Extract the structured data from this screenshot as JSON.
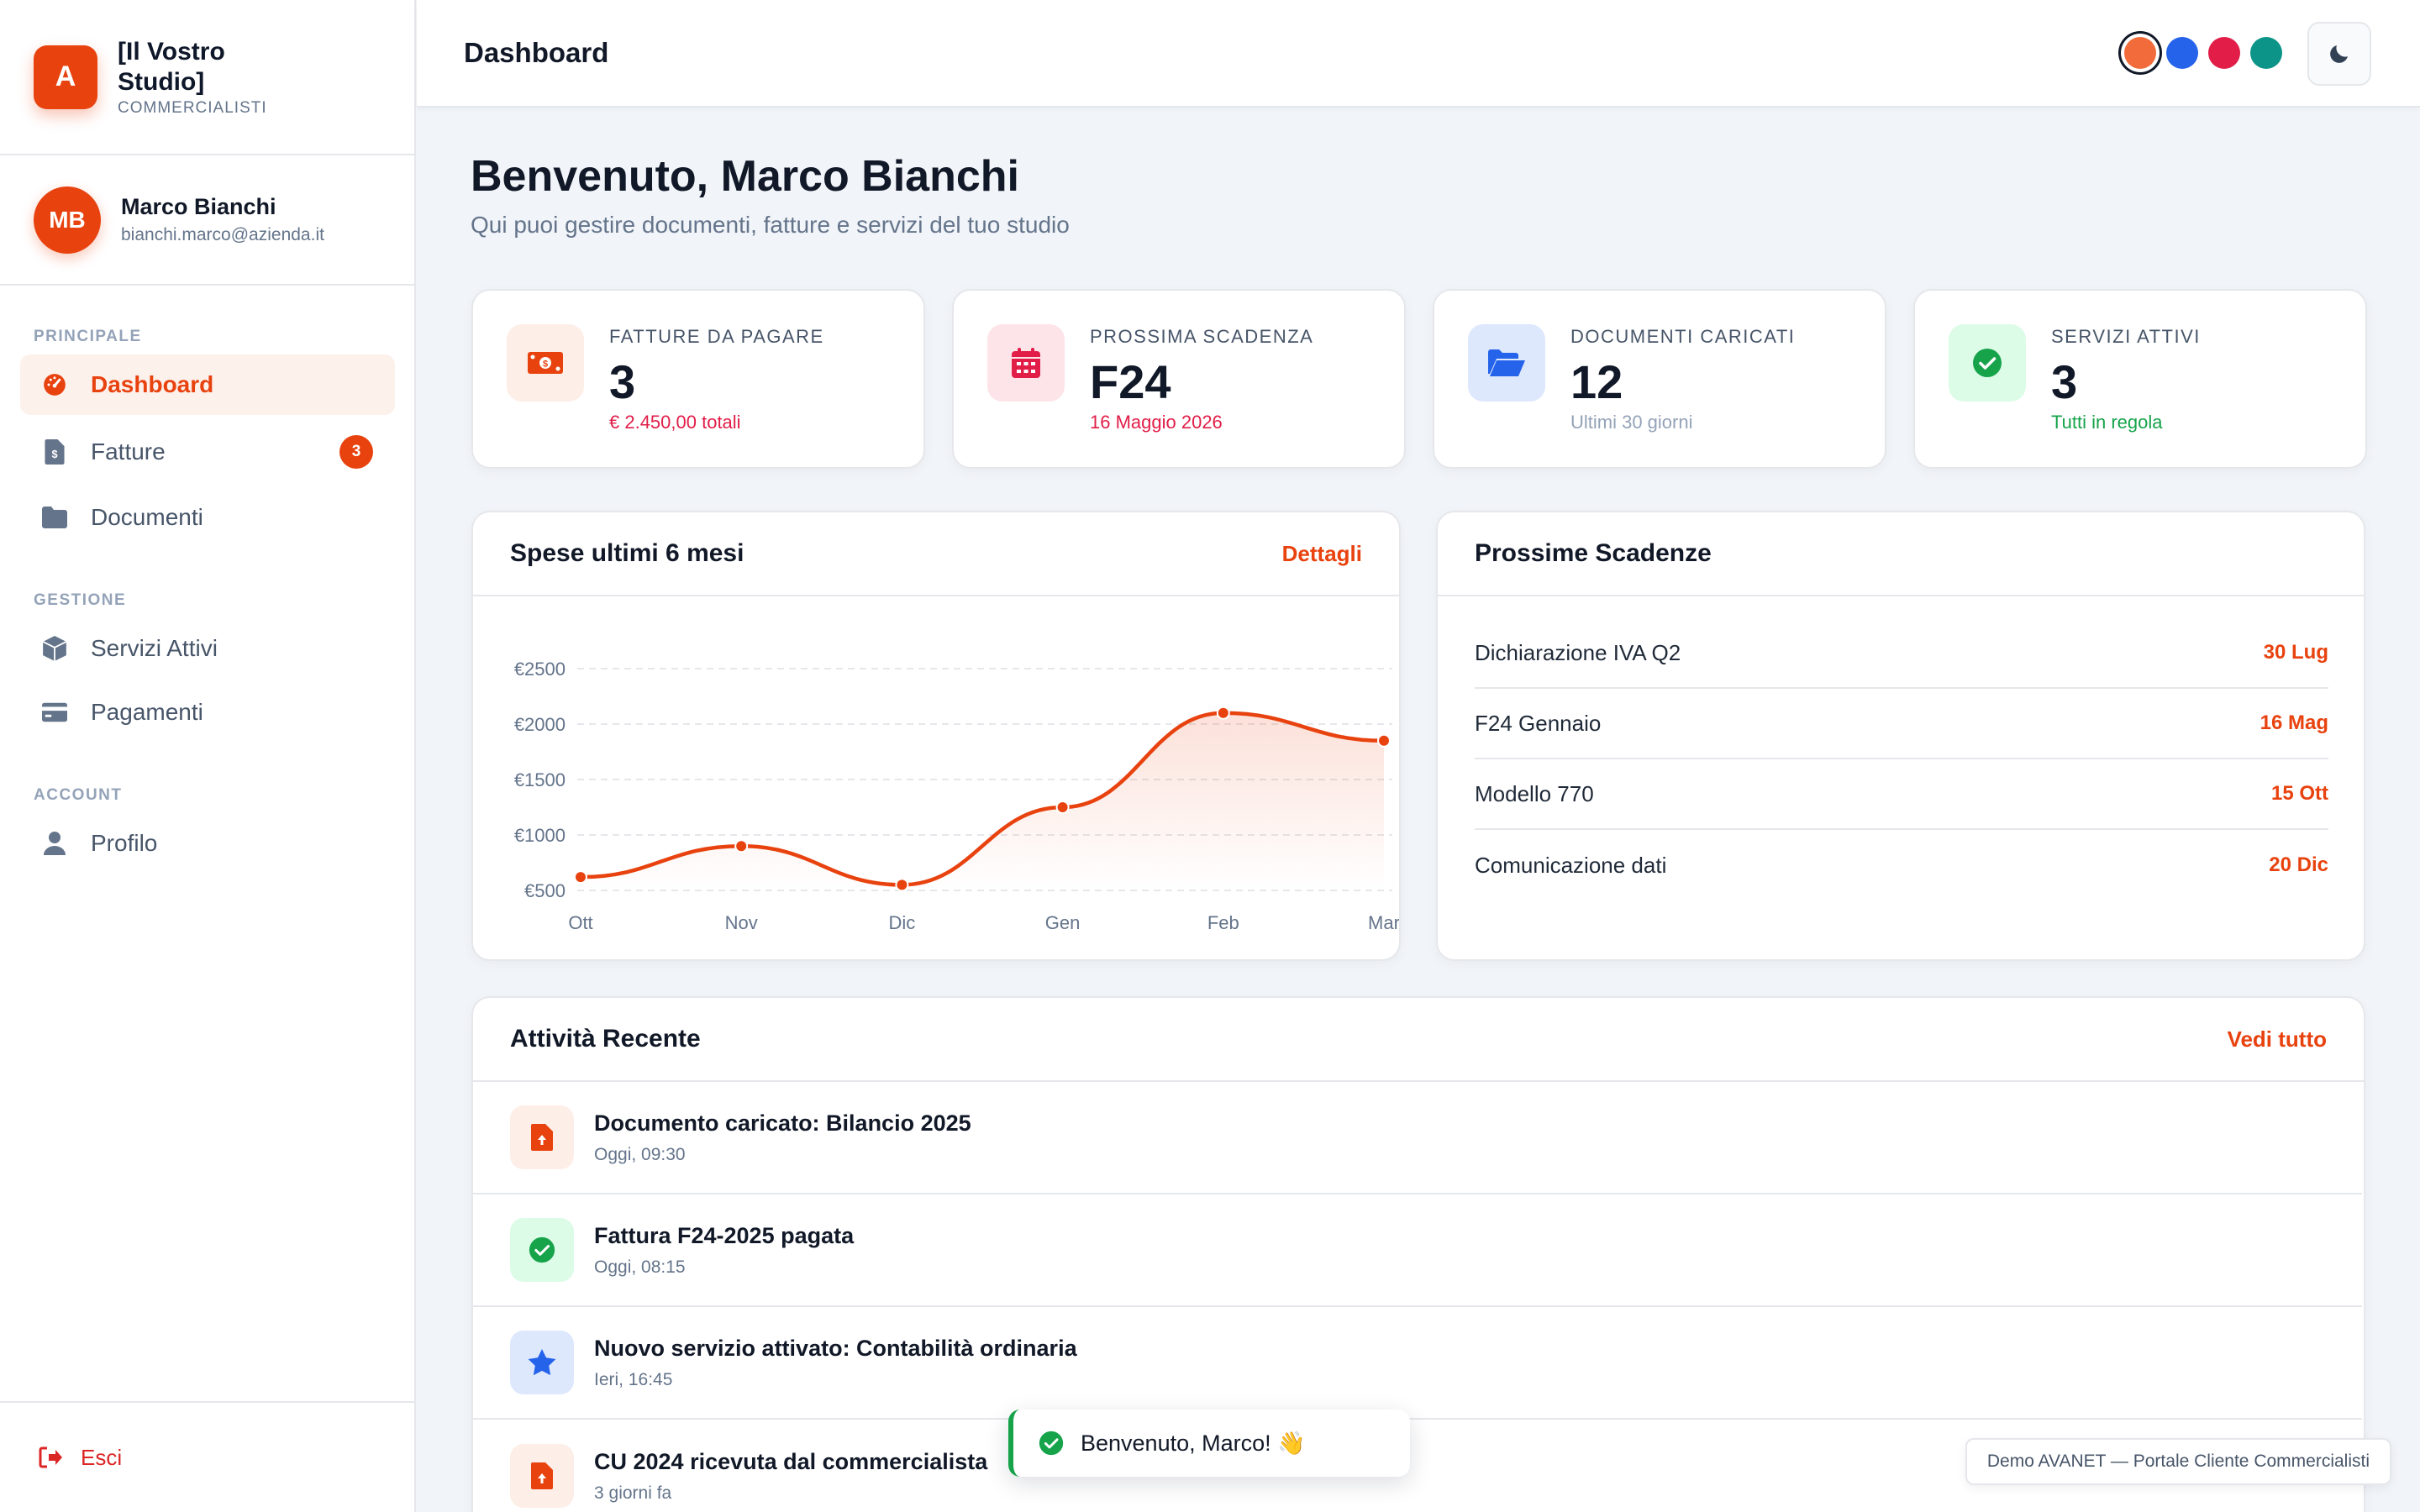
{
  "brand": {
    "logo_letter": "A",
    "name": "[Il Vostro Studio]",
    "subtitle": "COMMERCIALISTI"
  },
  "user": {
    "initials": "MB",
    "name": "Marco Bianchi",
    "email": "bianchi.marco@azienda.it"
  },
  "nav": {
    "sections": [
      "PRINCIPALE",
      "GESTIONE",
      "ACCOUNT"
    ],
    "items": [
      {
        "label": "Dashboard",
        "icon": "gauge-icon",
        "active": true
      },
      {
        "label": "Fatture",
        "icon": "invoice-icon",
        "badge": "3"
      },
      {
        "label": "Documenti",
        "icon": "folder-icon"
      },
      {
        "label": "Servizi Attivi",
        "icon": "box-icon"
      },
      {
        "label": "Pagamenti",
        "icon": "credit-card-icon"
      },
      {
        "label": "Profilo",
        "icon": "user-icon"
      }
    ],
    "logout": "Esci"
  },
  "header": {
    "title": "Dashboard",
    "theme_colors": [
      "#f26b3a",
      "#2563eb",
      "#e11d48",
      "#0d9488"
    ],
    "theme_toggle_icon": "moon-icon"
  },
  "welcome": {
    "title": "Benvenuto, Marco Bianchi",
    "subtitle": "Qui puoi gestire documenti, fatture e servizi del tuo studio"
  },
  "stats": [
    {
      "label": "FATTURE DA PAGARE",
      "value": "3",
      "foot": "€ 2.450,00 totali",
      "icon": "money-icon",
      "color": "#e8420f"
    },
    {
      "label": "PROSSIMA SCADENZA",
      "value": "F24",
      "foot": "16 Maggio 2026",
      "icon": "calendar-icon",
      "color": "#e11d48"
    },
    {
      "label": "DOCUMENTI CARICATI",
      "value": "12",
      "foot": "Ultimi 30 giorni",
      "icon": "folder-open-icon",
      "color": "#2563eb"
    },
    {
      "label": "SERVIZI ATTIVI",
      "value": "3",
      "foot": "Tutti in regola",
      "icon": "check-circle-icon",
      "color": "#16a34a"
    }
  ],
  "expenses": {
    "title": "Spese ultimi 6 mesi",
    "link": "Dettagli"
  },
  "chart_data": {
    "type": "line",
    "categories": [
      "Ott",
      "Nov",
      "Dic",
      "Gen",
      "Feb",
      "Mar"
    ],
    "values": [
      620,
      900,
      550,
      1250,
      2100,
      1850
    ],
    "yticks": [
      "€2500",
      "€2000",
      "€1500",
      "€1000",
      "€500"
    ],
    "ylim": [
      500,
      2500
    ],
    "grid": true,
    "color": "#e8420f"
  },
  "deadlines": {
    "title": "Prossime Scadenze",
    "items": [
      {
        "name": "Dichiarazione IVA Q2",
        "date": "30 Lug"
      },
      {
        "name": "F24 Gennaio",
        "date": "16 Mag"
      },
      {
        "name": "Modello 770",
        "date": "15 Ott"
      },
      {
        "name": "Comunicazione dati",
        "date": "20 Dic"
      }
    ]
  },
  "activity": {
    "title": "Attività Recente",
    "link": "Vedi tutto",
    "items": [
      {
        "title": "Documento caricato: Bilancio 2025",
        "time": "Oggi, 09:30",
        "icon": "file-upload-icon"
      },
      {
        "title": "Fattura F24-2025 pagata",
        "time": "Oggi, 08:15",
        "icon": "check-circle-icon"
      },
      {
        "title": "Nuovo servizio attivato: Contabilità ordinaria",
        "time": "Ieri, 16:45",
        "icon": "star-icon"
      },
      {
        "title": "CU 2024 ricevuta dal commercialista",
        "time": "3 giorni fa",
        "icon": "file-upload-icon"
      }
    ]
  },
  "toast": {
    "message": "Benvenuto, Marco! 👋"
  },
  "footer_note": "Demo AVANET — Portale Cliente Commercialisti"
}
